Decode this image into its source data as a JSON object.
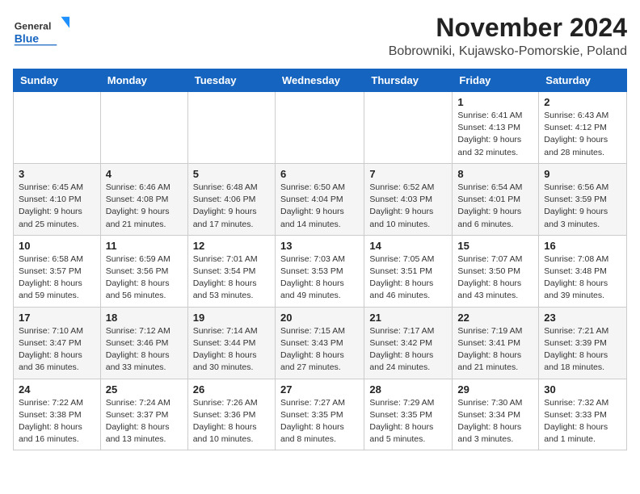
{
  "header": {
    "logo_general": "General",
    "logo_blue": "Blue",
    "month_title": "November 2024",
    "location": "Bobrowniki, Kujawsko-Pomorskie, Poland"
  },
  "calendar": {
    "days_of_week": [
      "Sunday",
      "Monday",
      "Tuesday",
      "Wednesday",
      "Thursday",
      "Friday",
      "Saturday"
    ],
    "weeks": [
      [
        {
          "day": "",
          "info": ""
        },
        {
          "day": "",
          "info": ""
        },
        {
          "day": "",
          "info": ""
        },
        {
          "day": "",
          "info": ""
        },
        {
          "day": "",
          "info": ""
        },
        {
          "day": "1",
          "info": "Sunrise: 6:41 AM\nSunset: 4:13 PM\nDaylight: 9 hours\nand 32 minutes."
        },
        {
          "day": "2",
          "info": "Sunrise: 6:43 AM\nSunset: 4:12 PM\nDaylight: 9 hours\nand 28 minutes."
        }
      ],
      [
        {
          "day": "3",
          "info": "Sunrise: 6:45 AM\nSunset: 4:10 PM\nDaylight: 9 hours\nand 25 minutes."
        },
        {
          "day": "4",
          "info": "Sunrise: 6:46 AM\nSunset: 4:08 PM\nDaylight: 9 hours\nand 21 minutes."
        },
        {
          "day": "5",
          "info": "Sunrise: 6:48 AM\nSunset: 4:06 PM\nDaylight: 9 hours\nand 17 minutes."
        },
        {
          "day": "6",
          "info": "Sunrise: 6:50 AM\nSunset: 4:04 PM\nDaylight: 9 hours\nand 14 minutes."
        },
        {
          "day": "7",
          "info": "Sunrise: 6:52 AM\nSunset: 4:03 PM\nDaylight: 9 hours\nand 10 minutes."
        },
        {
          "day": "8",
          "info": "Sunrise: 6:54 AM\nSunset: 4:01 PM\nDaylight: 9 hours\nand 6 minutes."
        },
        {
          "day": "9",
          "info": "Sunrise: 6:56 AM\nSunset: 3:59 PM\nDaylight: 9 hours\nand 3 minutes."
        }
      ],
      [
        {
          "day": "10",
          "info": "Sunrise: 6:58 AM\nSunset: 3:57 PM\nDaylight: 8 hours\nand 59 minutes."
        },
        {
          "day": "11",
          "info": "Sunrise: 6:59 AM\nSunset: 3:56 PM\nDaylight: 8 hours\nand 56 minutes."
        },
        {
          "day": "12",
          "info": "Sunrise: 7:01 AM\nSunset: 3:54 PM\nDaylight: 8 hours\nand 53 minutes."
        },
        {
          "day": "13",
          "info": "Sunrise: 7:03 AM\nSunset: 3:53 PM\nDaylight: 8 hours\nand 49 minutes."
        },
        {
          "day": "14",
          "info": "Sunrise: 7:05 AM\nSunset: 3:51 PM\nDaylight: 8 hours\nand 46 minutes."
        },
        {
          "day": "15",
          "info": "Sunrise: 7:07 AM\nSunset: 3:50 PM\nDaylight: 8 hours\nand 43 minutes."
        },
        {
          "day": "16",
          "info": "Sunrise: 7:08 AM\nSunset: 3:48 PM\nDaylight: 8 hours\nand 39 minutes."
        }
      ],
      [
        {
          "day": "17",
          "info": "Sunrise: 7:10 AM\nSunset: 3:47 PM\nDaylight: 8 hours\nand 36 minutes."
        },
        {
          "day": "18",
          "info": "Sunrise: 7:12 AM\nSunset: 3:46 PM\nDaylight: 8 hours\nand 33 minutes."
        },
        {
          "day": "19",
          "info": "Sunrise: 7:14 AM\nSunset: 3:44 PM\nDaylight: 8 hours\nand 30 minutes."
        },
        {
          "day": "20",
          "info": "Sunrise: 7:15 AM\nSunset: 3:43 PM\nDaylight: 8 hours\nand 27 minutes."
        },
        {
          "day": "21",
          "info": "Sunrise: 7:17 AM\nSunset: 3:42 PM\nDaylight: 8 hours\nand 24 minutes."
        },
        {
          "day": "22",
          "info": "Sunrise: 7:19 AM\nSunset: 3:41 PM\nDaylight: 8 hours\nand 21 minutes."
        },
        {
          "day": "23",
          "info": "Sunrise: 7:21 AM\nSunset: 3:39 PM\nDaylight: 8 hours\nand 18 minutes."
        }
      ],
      [
        {
          "day": "24",
          "info": "Sunrise: 7:22 AM\nSunset: 3:38 PM\nDaylight: 8 hours\nand 16 minutes."
        },
        {
          "day": "25",
          "info": "Sunrise: 7:24 AM\nSunset: 3:37 PM\nDaylight: 8 hours\nand 13 minutes."
        },
        {
          "day": "26",
          "info": "Sunrise: 7:26 AM\nSunset: 3:36 PM\nDaylight: 8 hours\nand 10 minutes."
        },
        {
          "day": "27",
          "info": "Sunrise: 7:27 AM\nSunset: 3:35 PM\nDaylight: 8 hours\nand 8 minutes."
        },
        {
          "day": "28",
          "info": "Sunrise: 7:29 AM\nSunset: 3:35 PM\nDaylight: 8 hours\nand 5 minutes."
        },
        {
          "day": "29",
          "info": "Sunrise: 7:30 AM\nSunset: 3:34 PM\nDaylight: 8 hours\nand 3 minutes."
        },
        {
          "day": "30",
          "info": "Sunrise: 7:32 AM\nSunset: 3:33 PM\nDaylight: 8 hours\nand 1 minute."
        }
      ]
    ]
  }
}
